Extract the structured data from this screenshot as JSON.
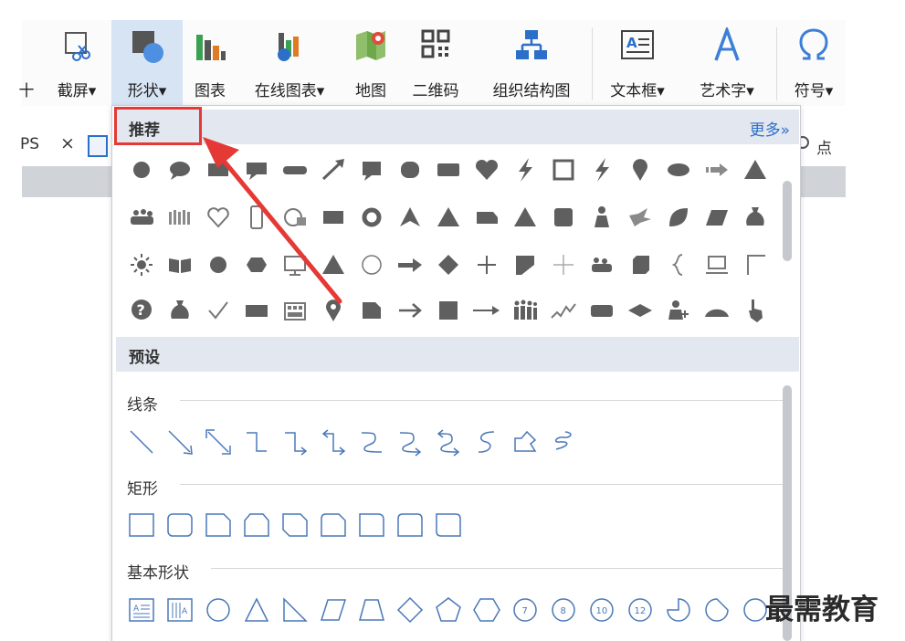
{
  "ribbon": {
    "cut_label": "十",
    "items": [
      {
        "label": "截屏",
        "dropdown": "▾",
        "icon": "screenshot-scissors-icon"
      },
      {
        "label": "形状",
        "dropdown": "▾",
        "icon": "shapes-icon"
      },
      {
        "label": "图表",
        "icon": "chart-icon"
      },
      {
        "label": "在线图表",
        "dropdown": "▾",
        "icon": "online-chart-icon"
      },
      {
        "label": "地图",
        "icon": "map-icon"
      },
      {
        "label": "二维码",
        "icon": "qr-code-icon"
      },
      {
        "label": "组织结构图",
        "icon": "org-chart-icon"
      },
      {
        "label": "文本框",
        "dropdown": "▾",
        "icon": "text-box-icon"
      },
      {
        "label": "艺术字",
        "dropdown": "▾",
        "icon": "word-art-icon"
      },
      {
        "label": "符号",
        "dropdown": "▾",
        "icon": "symbol-omega-icon"
      }
    ]
  },
  "tabs": {
    "left_text": "PS",
    "close": "×",
    "right_text": "点"
  },
  "panel": {
    "recommended": "推荐",
    "more": "更多»",
    "preset": "预设",
    "lines_label": "线条",
    "rect_label": "矩形",
    "basic_label": "基本形状",
    "basic_numbers": [
      "7",
      "8",
      "10",
      "12"
    ]
  },
  "watermark": "最需教育",
  "colors": {
    "accent_blue": "#2c6fc9",
    "shape_gray": "#5f5f5f",
    "outline_blue": "#4a78b8",
    "highlight_red": "#e53935"
  }
}
